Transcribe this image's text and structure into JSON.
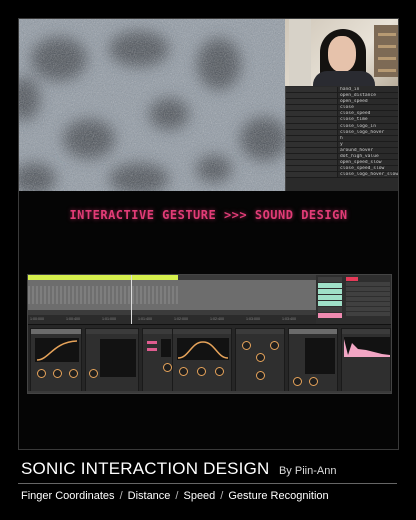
{
  "headline": "INTERACTIVE GESTURE >>> SOUND DESIGN",
  "osc_params": [
    "hand_in",
    "open_distance",
    "open_speed",
    "close",
    "close_speed",
    "close_time",
    "close_logo_in",
    "close_logo_hover",
    "h",
    "y",
    "around_hover",
    "dot_high_value",
    "open_speed_slow",
    "close_speed_slow",
    "close_logo_hover_slow"
  ],
  "timeline_labels": [
    "1:00:000",
    "1:00:400",
    "1:01:000",
    "1:01:400",
    "1:02:000",
    "1:02:400",
    "1:03:000",
    "1:03:400"
  ],
  "footer": {
    "title": "SONIC INTERACTION DESIGN",
    "by_prefix": "By",
    "author": "Piin-Ann",
    "features": [
      "Finger Coordinates",
      "Distance",
      "Speed",
      "Gesture Recognition"
    ],
    "separator": "/"
  },
  "colors": {
    "headline": "#e23c77",
    "clip": "#d6f04d",
    "knob": "#e6a35a",
    "accent_pink": "#df5c8f"
  }
}
